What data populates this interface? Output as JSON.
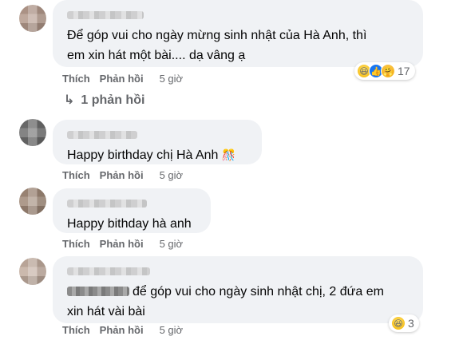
{
  "comments": [
    {
      "text_line1": "Để góp vui cho ngày mừng sinh nhật của Hà Anh, thì",
      "text_line2": "em xin hát một bài.... dạ vâng ạ",
      "like": "Thích",
      "reply": "Phản hồi",
      "time": "5 giờ",
      "reactions": [
        "haha",
        "like",
        "care"
      ],
      "reaction_count": "17"
    },
    {
      "text": "Happy birthday chị Hà Anh",
      "emoji": "🎊",
      "like": "Thích",
      "reply": "Phản hồi",
      "time": "5 giờ"
    },
    {
      "text": "Happy bithday hà anh",
      "like": "Thích",
      "reply": "Phản hồi",
      "time": "5 giờ"
    },
    {
      "text_line1": "để góp vui cho ngày sinh nhật chị, 2 đứa em",
      "text_line2": "xin hát vài bài",
      "like": "Thích",
      "reply": "Phản hồi",
      "time": "5 giờ",
      "reactions": [
        "haha"
      ],
      "reaction_count": "3"
    }
  ],
  "replies_link": "1 phản hồi",
  "icons": {
    "reply_arrow": "reply-arrow-icon",
    "haha": "haha-reaction-icon",
    "like": "like-reaction-icon",
    "care": "care-reaction-icon"
  }
}
